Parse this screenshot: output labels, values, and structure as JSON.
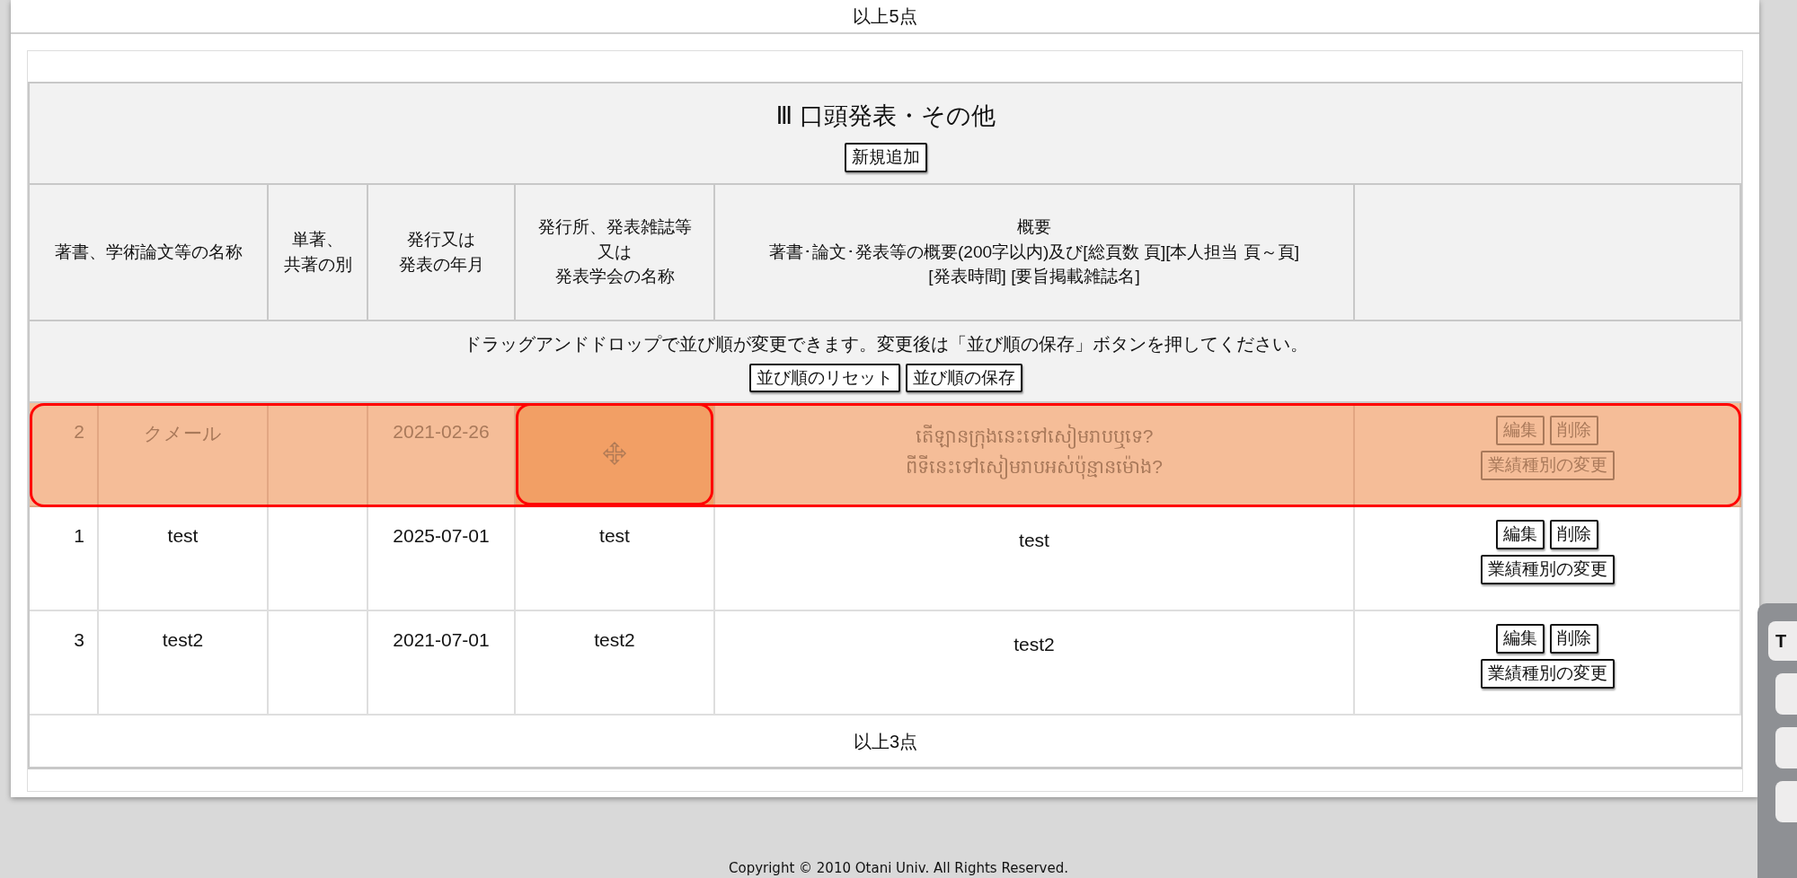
{
  "top_total": "以上5点",
  "section": {
    "title": "Ⅲ 口頭発表・その他",
    "add_button": "新規追加",
    "columns": [
      {
        "lines": [
          "著書、学術論文等の名称"
        ]
      },
      {
        "lines": [
          "単著、",
          "共著の別"
        ]
      },
      {
        "lines": [
          "発行又は",
          "発表の年月"
        ]
      },
      {
        "lines": [
          "発行所、発表雑誌等",
          "又は",
          "発表学会の名称"
        ]
      },
      {
        "lines": [
          "概要",
          "著書･論文･発表等の概要(200字以内)及び[総頁数 頁][本人担当 頁～頁]",
          "[発表時間] [要旨掲載雑誌名]"
        ]
      }
    ],
    "notice": "ドラッグアンドドロップで並び順が変更できます。変更後は「並び順の保存」ボタンを押してください。",
    "reset_button": "並び順のリセット",
    "save_button": "並び順の保存",
    "rows": [
      {
        "no": "2",
        "title": "クメール",
        "date": "2021-02-26",
        "summary": [
          "តើឡានក្រុងនេះទៅសៀមរាបឬទេ?",
          "ពីទីនេះទៅសៀមរាបអស់ប៉ុន្មានម៉ោង?"
        ],
        "edit": "編集",
        "delete": "削除",
        "change": "業績種別の変更",
        "dragging": true
      },
      {
        "no": "1",
        "title": "test",
        "date": "2025-07-01",
        "publisher": "test",
        "summary": [
          "test"
        ],
        "edit": "編集",
        "delete": "削除",
        "change": "業績種別の変更",
        "dragging": false
      },
      {
        "no": "3",
        "title": "test2",
        "date": "2021-07-01",
        "publisher": "test2",
        "summary": [
          "test2"
        ],
        "edit": "編集",
        "delete": "削除",
        "change": "業績種別の変更",
        "dragging": false
      }
    ],
    "total": "以上3点"
  },
  "copyright": "Copyright © 2010 Otani Univ. All Rights Reserved.",
  "side_toolbar": {
    "buttons": [
      "T"
    ]
  }
}
